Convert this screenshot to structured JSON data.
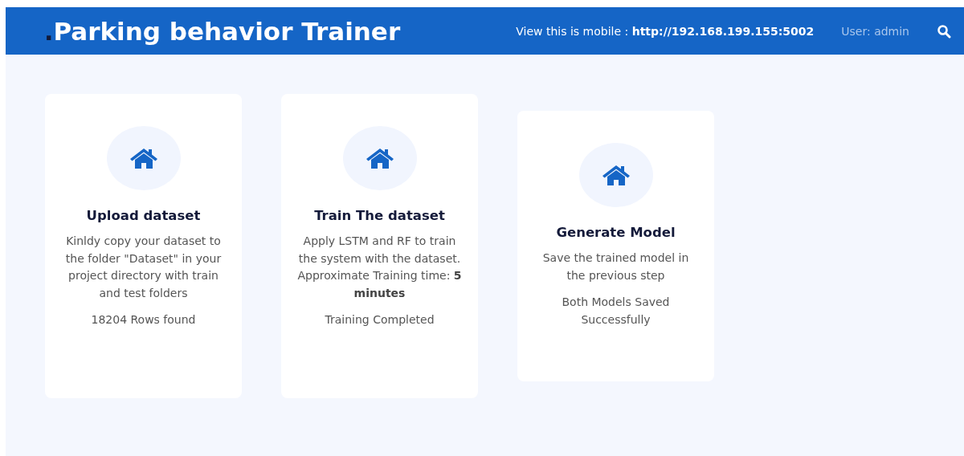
{
  "header": {
    "logo_dot": ".",
    "title": "Parking behavior Trainer",
    "mobile_label": "View this is mobile : **http://192.168.199.155:5002**",
    "user": "User: admin"
  },
  "cards": [
    {
      "title": "Upload dataset",
      "description": "Kinldy copy your dataset to the folder \"Dataset\" in your project directory with train and test folders",
      "status": "18204 Rows found"
    },
    {
      "title": "Train The dataset",
      "description": "Apply LSTM and RF to train the system with the dataset. Approximate Training time: **5 minutes**",
      "status": "Training Completed"
    },
    {
      "title": "Generate Model",
      "description": "Save the trained model in the previous step",
      "status": "Both Models Saved Successfully"
    }
  ]
}
